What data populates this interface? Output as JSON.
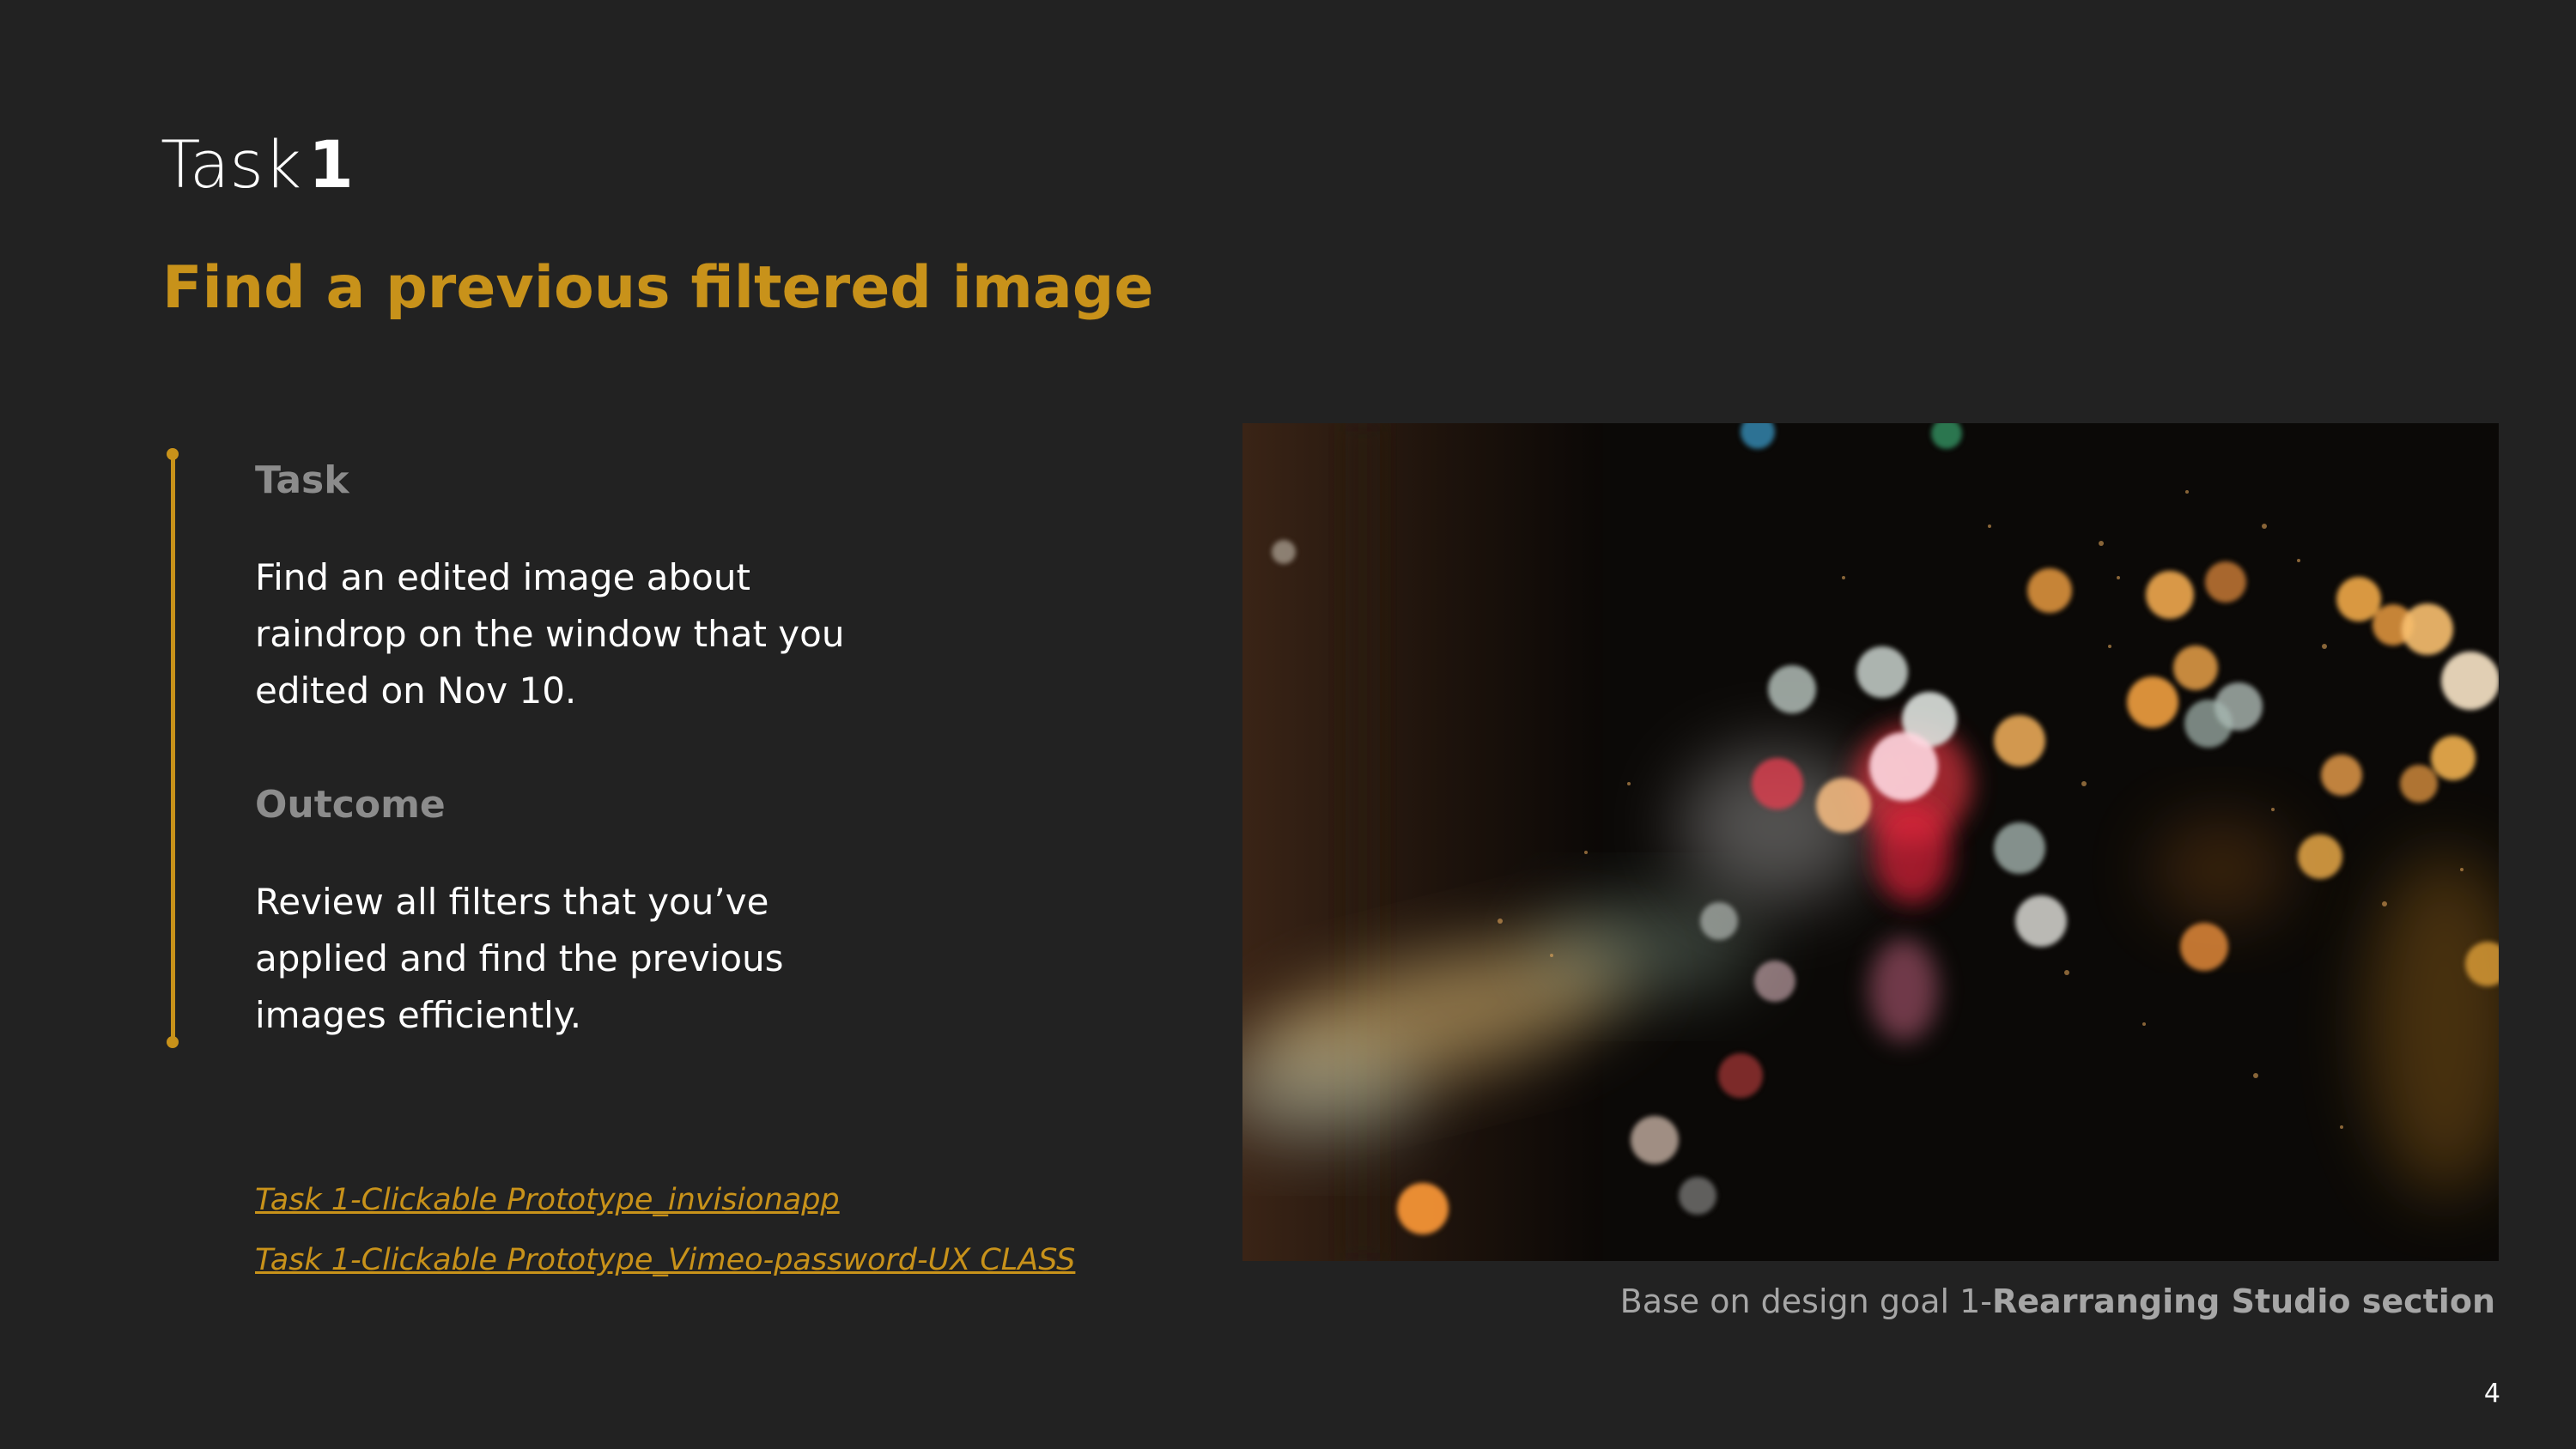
{
  "slide": {
    "title_prefix": "Task",
    "title_number": "1",
    "subtitle": "Find a previous filtered image",
    "task_heading": "Task",
    "task_body": "Find an edited image about raindrop on the window that you edited on Nov 10.",
    "outcome_heading": "Outcome",
    "outcome_body": "Review all filters that you’ve applied and find the previous images efficiently.",
    "links": [
      "Task 1-Clickable Prototype_invisionapp",
      "Task 1-Clickable Prototype_Vimeo-password-UX CLASS"
    ],
    "caption_prefix": "Base on design goal 1-",
    "caption_bold": "Rearranging Studio section",
    "page_number": "4"
  },
  "colors": {
    "background": "#222222",
    "accent": "#c8921a",
    "heading_gray": "#8c8c8c",
    "caption_gray": "#a6a6a6",
    "text": "#ffffff"
  },
  "image": {
    "subject": "raindrops-on-window-bokeh-photo"
  }
}
